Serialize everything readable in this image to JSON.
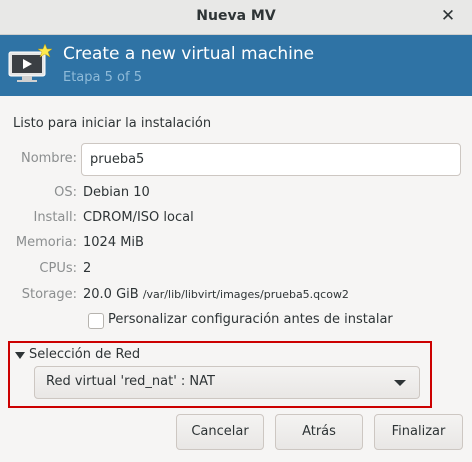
{
  "window": {
    "title": "Nueva MV",
    "close_glyph": "✕"
  },
  "banner": {
    "icon": "vm-monitor-icon",
    "heading": "Create a new virtual machine",
    "step": "Etapa 5 of 5",
    "background": "#2f73a5"
  },
  "summary": {
    "ready_text": "Listo para iniciar la instalación",
    "name_label": "Nombre:",
    "name_value": "prueba5",
    "os_label": "OS:",
    "os_value": "Debian 10",
    "install_label": "Install:",
    "install_value": "CDROM/ISO local",
    "memory_label": "Memoria:",
    "memory_value": "1024 MiB",
    "cpus_label": "CPUs:",
    "cpus_value": "2",
    "storage_label": "Storage:",
    "storage_value": "20.0 GiB",
    "storage_path": "/var/lib/libvirt/images/prueba5.qcow2"
  },
  "customize": {
    "label": "Personalizar configuración antes de instalar",
    "checked": false
  },
  "network": {
    "expander_label": "Selección de Red",
    "expanded": true,
    "selected": "Red virtual 'red_nat' : NAT",
    "highlight_color": "#cc0000"
  },
  "buttons": {
    "cancel": "Cancelar",
    "back": "Atrás",
    "finish": "Finalizar"
  }
}
